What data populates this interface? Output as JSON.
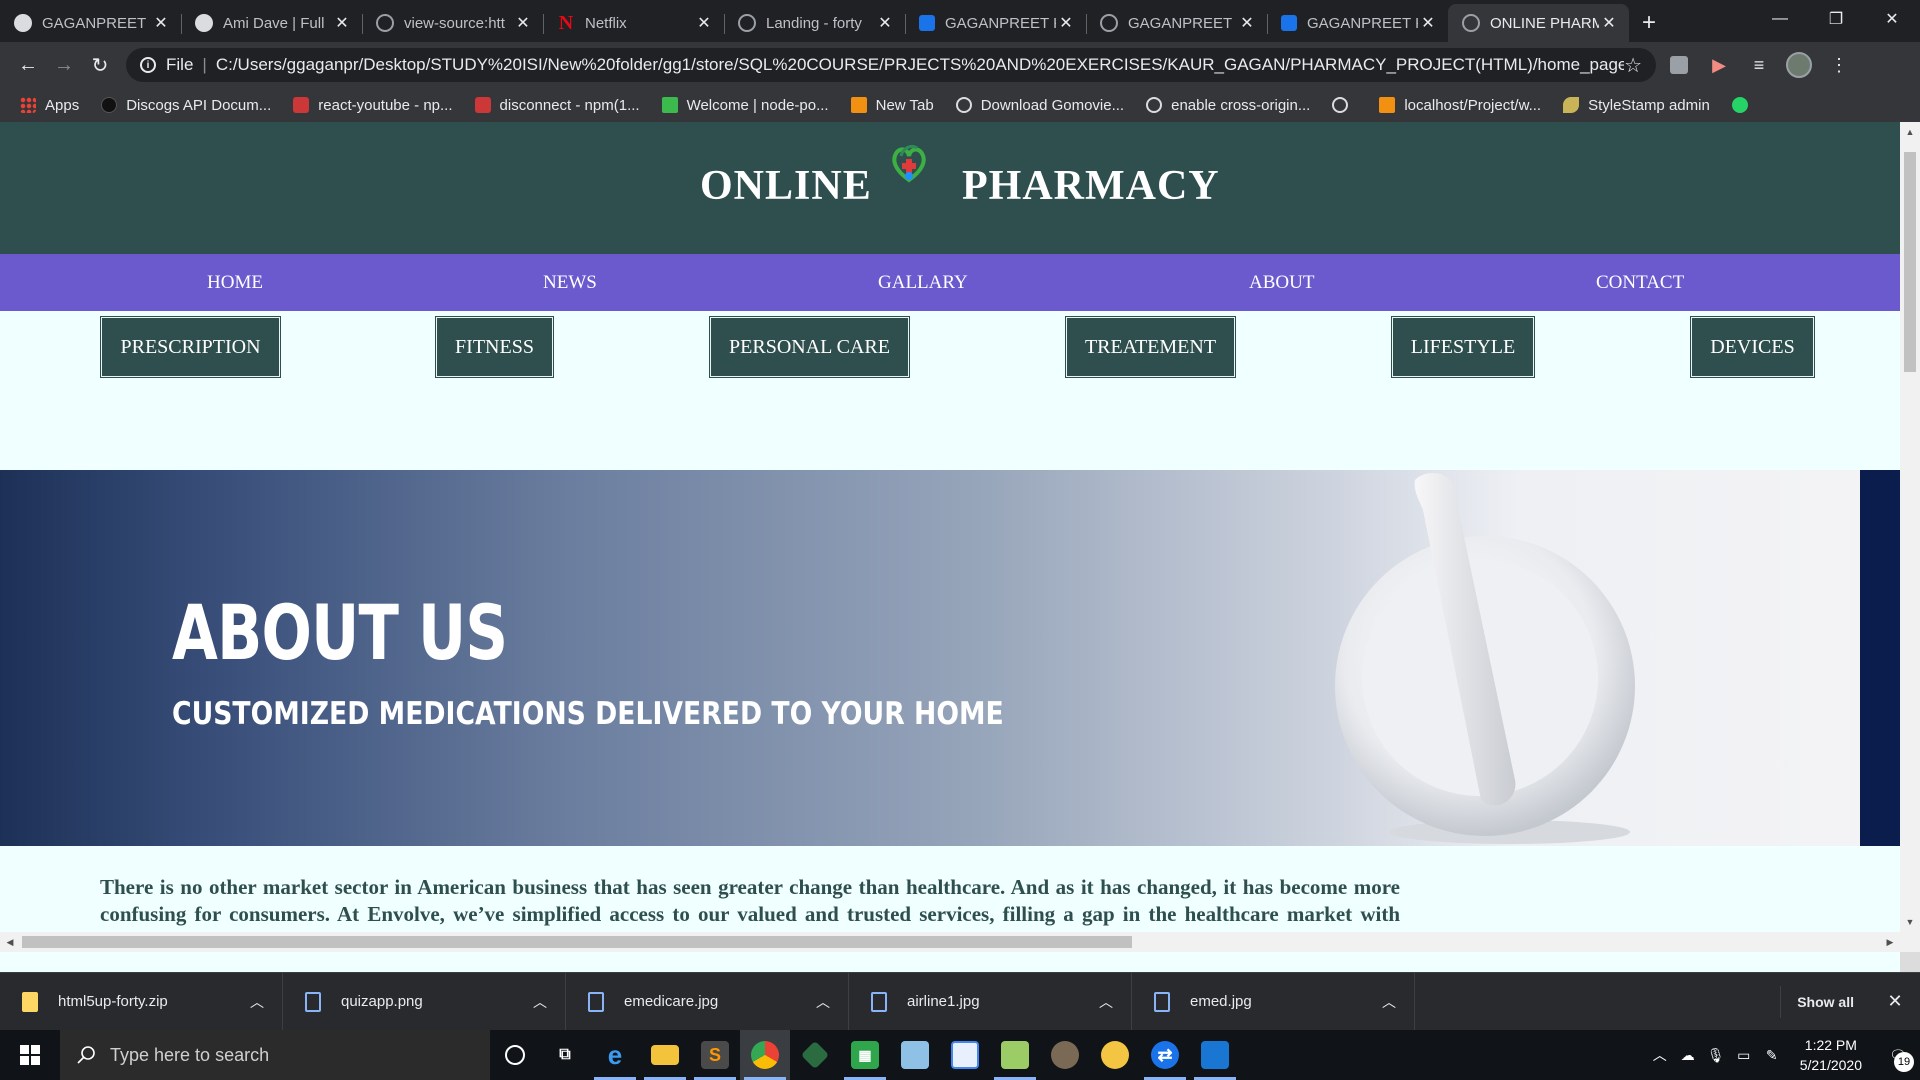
{
  "browser": {
    "tabs": [
      {
        "title": "GAGANPREET K",
        "favicon": "globe-icon"
      },
      {
        "title": "Ami Dave | Full",
        "favicon": "globe-icon"
      },
      {
        "title": "view-source:htt",
        "favicon": "globe-icon"
      },
      {
        "title": "Netflix",
        "favicon": "netflix-icon"
      },
      {
        "title": "Landing - forty",
        "favicon": "globe-icon"
      },
      {
        "title": "GAGANPREET K",
        "favicon": "bootstrap-icon"
      },
      {
        "title": "GAGANPREET K",
        "favicon": "globe-icon"
      },
      {
        "title": "GAGANPREET K",
        "favicon": "bootstrap-icon"
      },
      {
        "title": "ONLINE PHARM",
        "favicon": "globe-icon",
        "active": true
      }
    ],
    "omnibox": {
      "scheme_label": "File",
      "url": "C:/Users/ggaganpr/Desktop/STUDY%20ISI/New%20folder/gg1/store/SQL%20COURSE/PRJECTS%20AND%20EXERCISES/KAUR_GAGAN/PHARMACY_PROJECT(HTML)/home_page.html"
    },
    "bookmarks": [
      {
        "label": "Apps",
        "icon": "apps-icon"
      },
      {
        "label": "Discogs API Docum...",
        "icon": "discogs-icon"
      },
      {
        "label": "react-youtube - np...",
        "icon": "npm-icon"
      },
      {
        "label": "disconnect - npm(1...",
        "icon": "npm-icon"
      },
      {
        "label": "Welcome | node-po...",
        "icon": "node-icon"
      },
      {
        "label": "New Tab",
        "icon": "new-tab-icon"
      },
      {
        "label": "Download Gomovie...",
        "icon": "globe-icon"
      },
      {
        "label": "enable cross-origin...",
        "icon": "globe-icon"
      },
      {
        "label": "",
        "icon": "globe-icon"
      },
      {
        "label": "localhost/Project/w...",
        "icon": "xampp-icon"
      },
      {
        "label": "StyleStamp admin",
        "icon": "leaf-icon"
      },
      {
        "label": "",
        "icon": "whatsapp-icon"
      }
    ]
  },
  "site": {
    "title_left": "ONLINE",
    "title_right": "PHARMACY",
    "nav": [
      "HOME",
      "NEWS",
      "GALLARY",
      "ABOUT",
      "CONTACT"
    ],
    "categories": [
      "PRESCRIPTION",
      "FITNESS",
      "PERSONAL CARE",
      "TREATEMENT",
      "LIFESTYLE",
      "DEVICES"
    ],
    "hero": {
      "heading": "ABOUT US",
      "subheading": "CUSTOMIZED MEDICATIONS DELIVERED TO YOUR HOME"
    },
    "about_text": "There is no other market sector in American business that has seen greater change than healthcare. And as it has changed, it has become more confusing for consumers. At Envolve, we’ve simplified access to our valued and trusted services, filling a gap in the healthcare market with flexible, cost-effective, comprehensive healthcare services. The Envolve family of health solutions is"
  },
  "downloads": {
    "items": [
      "html5up-forty.zip",
      "quizapp.png",
      "emedicare.jpg",
      "airline1.jpg",
      "emed.jpg"
    ],
    "show_all_label": "Show all"
  },
  "taskbar": {
    "search_placeholder": "Type here to search",
    "time": "1:22 PM",
    "date": "5/21/2020",
    "notification_count": "19"
  },
  "colors": {
    "header_bg": "#2f4f4f",
    "nav_bg": "#6a5acd",
    "page_bg": "#f0ffff"
  }
}
